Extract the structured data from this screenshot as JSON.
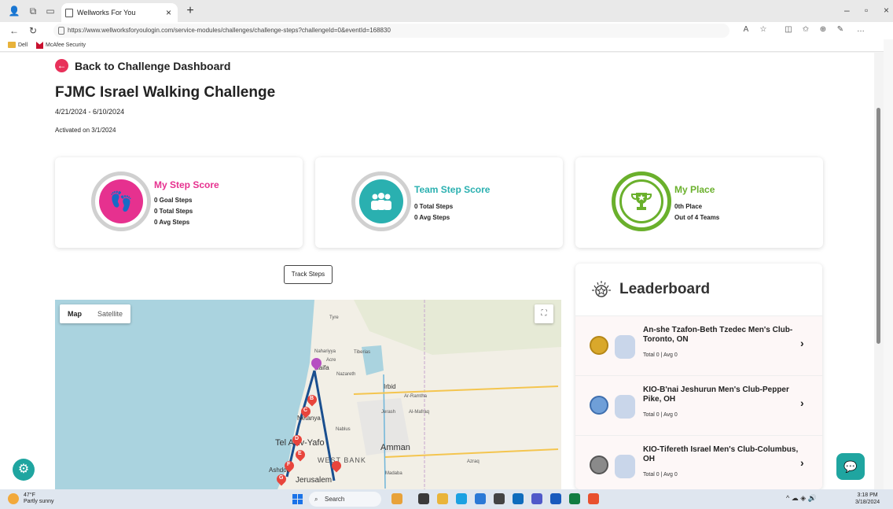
{
  "browser": {
    "tab_title": "Wellworks For You",
    "url": "https://www.wellworksforyoulogin.com/service-modules/challenges/challenge-steps?challengeId=0&eventId=168830",
    "bookmarks": [
      "Dell",
      "McAfee Security"
    ]
  },
  "page": {
    "back_label": "Back to Challenge Dashboard",
    "title": "FJMC Israel Walking Challenge",
    "dates": "4/21/2024 - 6/10/2024",
    "activated": "Activated on 3/1/2024",
    "track_steps": "Track Steps"
  },
  "cards": {
    "my_step": {
      "title": "My Step Score",
      "lines": [
        "0 Goal Steps",
        "0 Total Steps",
        "0 Avg Steps"
      ],
      "color": "#e6318f"
    },
    "team_step": {
      "title": "Team Step Score",
      "lines": [
        "0 Total Steps",
        "0 Avg Steps"
      ],
      "color": "#2ab0b0"
    },
    "my_place": {
      "title": "My Place",
      "lines": [
        "0th Place",
        "Out of 4 Teams"
      ],
      "color": "#6ab02c"
    }
  },
  "map": {
    "toggle": [
      "Map",
      "Satellite"
    ],
    "labels": [
      "Tyre",
      "Nahariyya",
      "Acre",
      "Haifa",
      "Tiberias",
      "Nazareth",
      "Irbid",
      "Ar-Ramtha",
      "Al-Mafraq",
      "Jerash",
      "Netanya",
      "Nablus",
      "Tel Aviv-Yafo",
      "Amman",
      "WEST BANK",
      "Ashdod",
      "Jerusalem",
      "Madaba",
      "Azraq"
    ],
    "markers": [
      "B",
      "C",
      "D",
      "E",
      "F",
      "G"
    ]
  },
  "leaderboard": {
    "title": "Leaderboard",
    "items": [
      {
        "name": "An-she Tzafon-Beth Tzedec Men's Club-Toronto, ON",
        "stats": "Total 0 | Avg 0",
        "medal": "#d9a82b"
      },
      {
        "name": "KIO-B'nai Jeshurun Men's Club-Pepper Pike, OH",
        "stats": "Total 0 | Avg 0",
        "medal": "#6f9fd8"
      },
      {
        "name": "KIO-Tifereth Israel Men's Club-Columbus, OH",
        "stats": "Total 0 | Avg 0",
        "medal": "#6a6a6a"
      }
    ]
  },
  "taskbar": {
    "temp": "47°F",
    "weather": "Partly sunny",
    "search": "Search",
    "time": "3:18 PM",
    "date": "3/18/2024"
  }
}
